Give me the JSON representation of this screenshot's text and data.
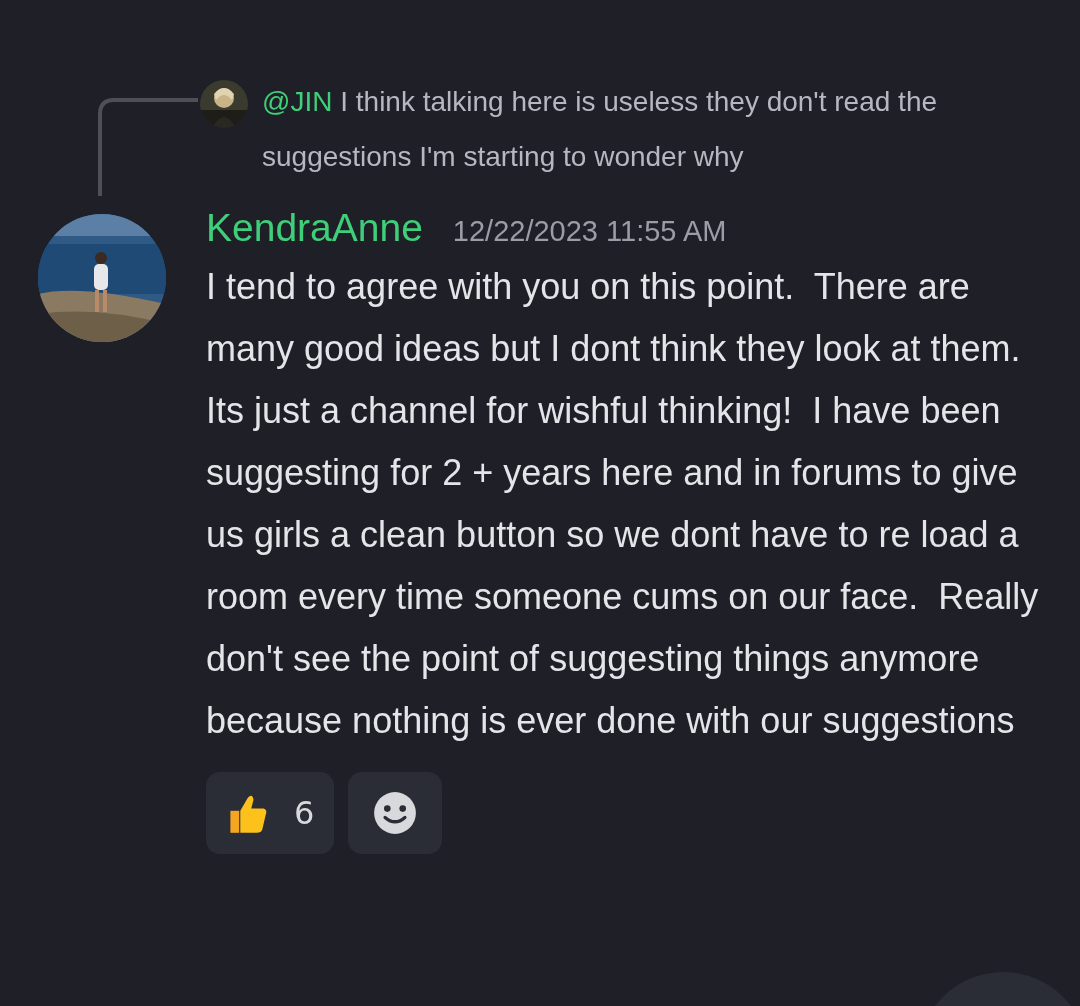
{
  "reply": {
    "mention": "@JIN",
    "text": "I think talking here is useless they don't read the suggestions I'm starting to wonder why"
  },
  "message": {
    "author": "KendraAnne",
    "timestamp": "12/22/2023 11:55 AM",
    "text": "I tend to agree with you on this point.  There are many good ideas but I dont think they look at them.  Its just a channel for wishful thinking!  I have been suggesting for 2 + years here and in forums to give us girls a clean button so we dont have to re load a room every time someone cums on our face.  Really don't see the point of suggesting things anymore because nothing is ever done with our suggestions"
  },
  "reactions": [
    {
      "kind": "thumbs-up",
      "count": "6",
      "selected": false
    }
  ]
}
